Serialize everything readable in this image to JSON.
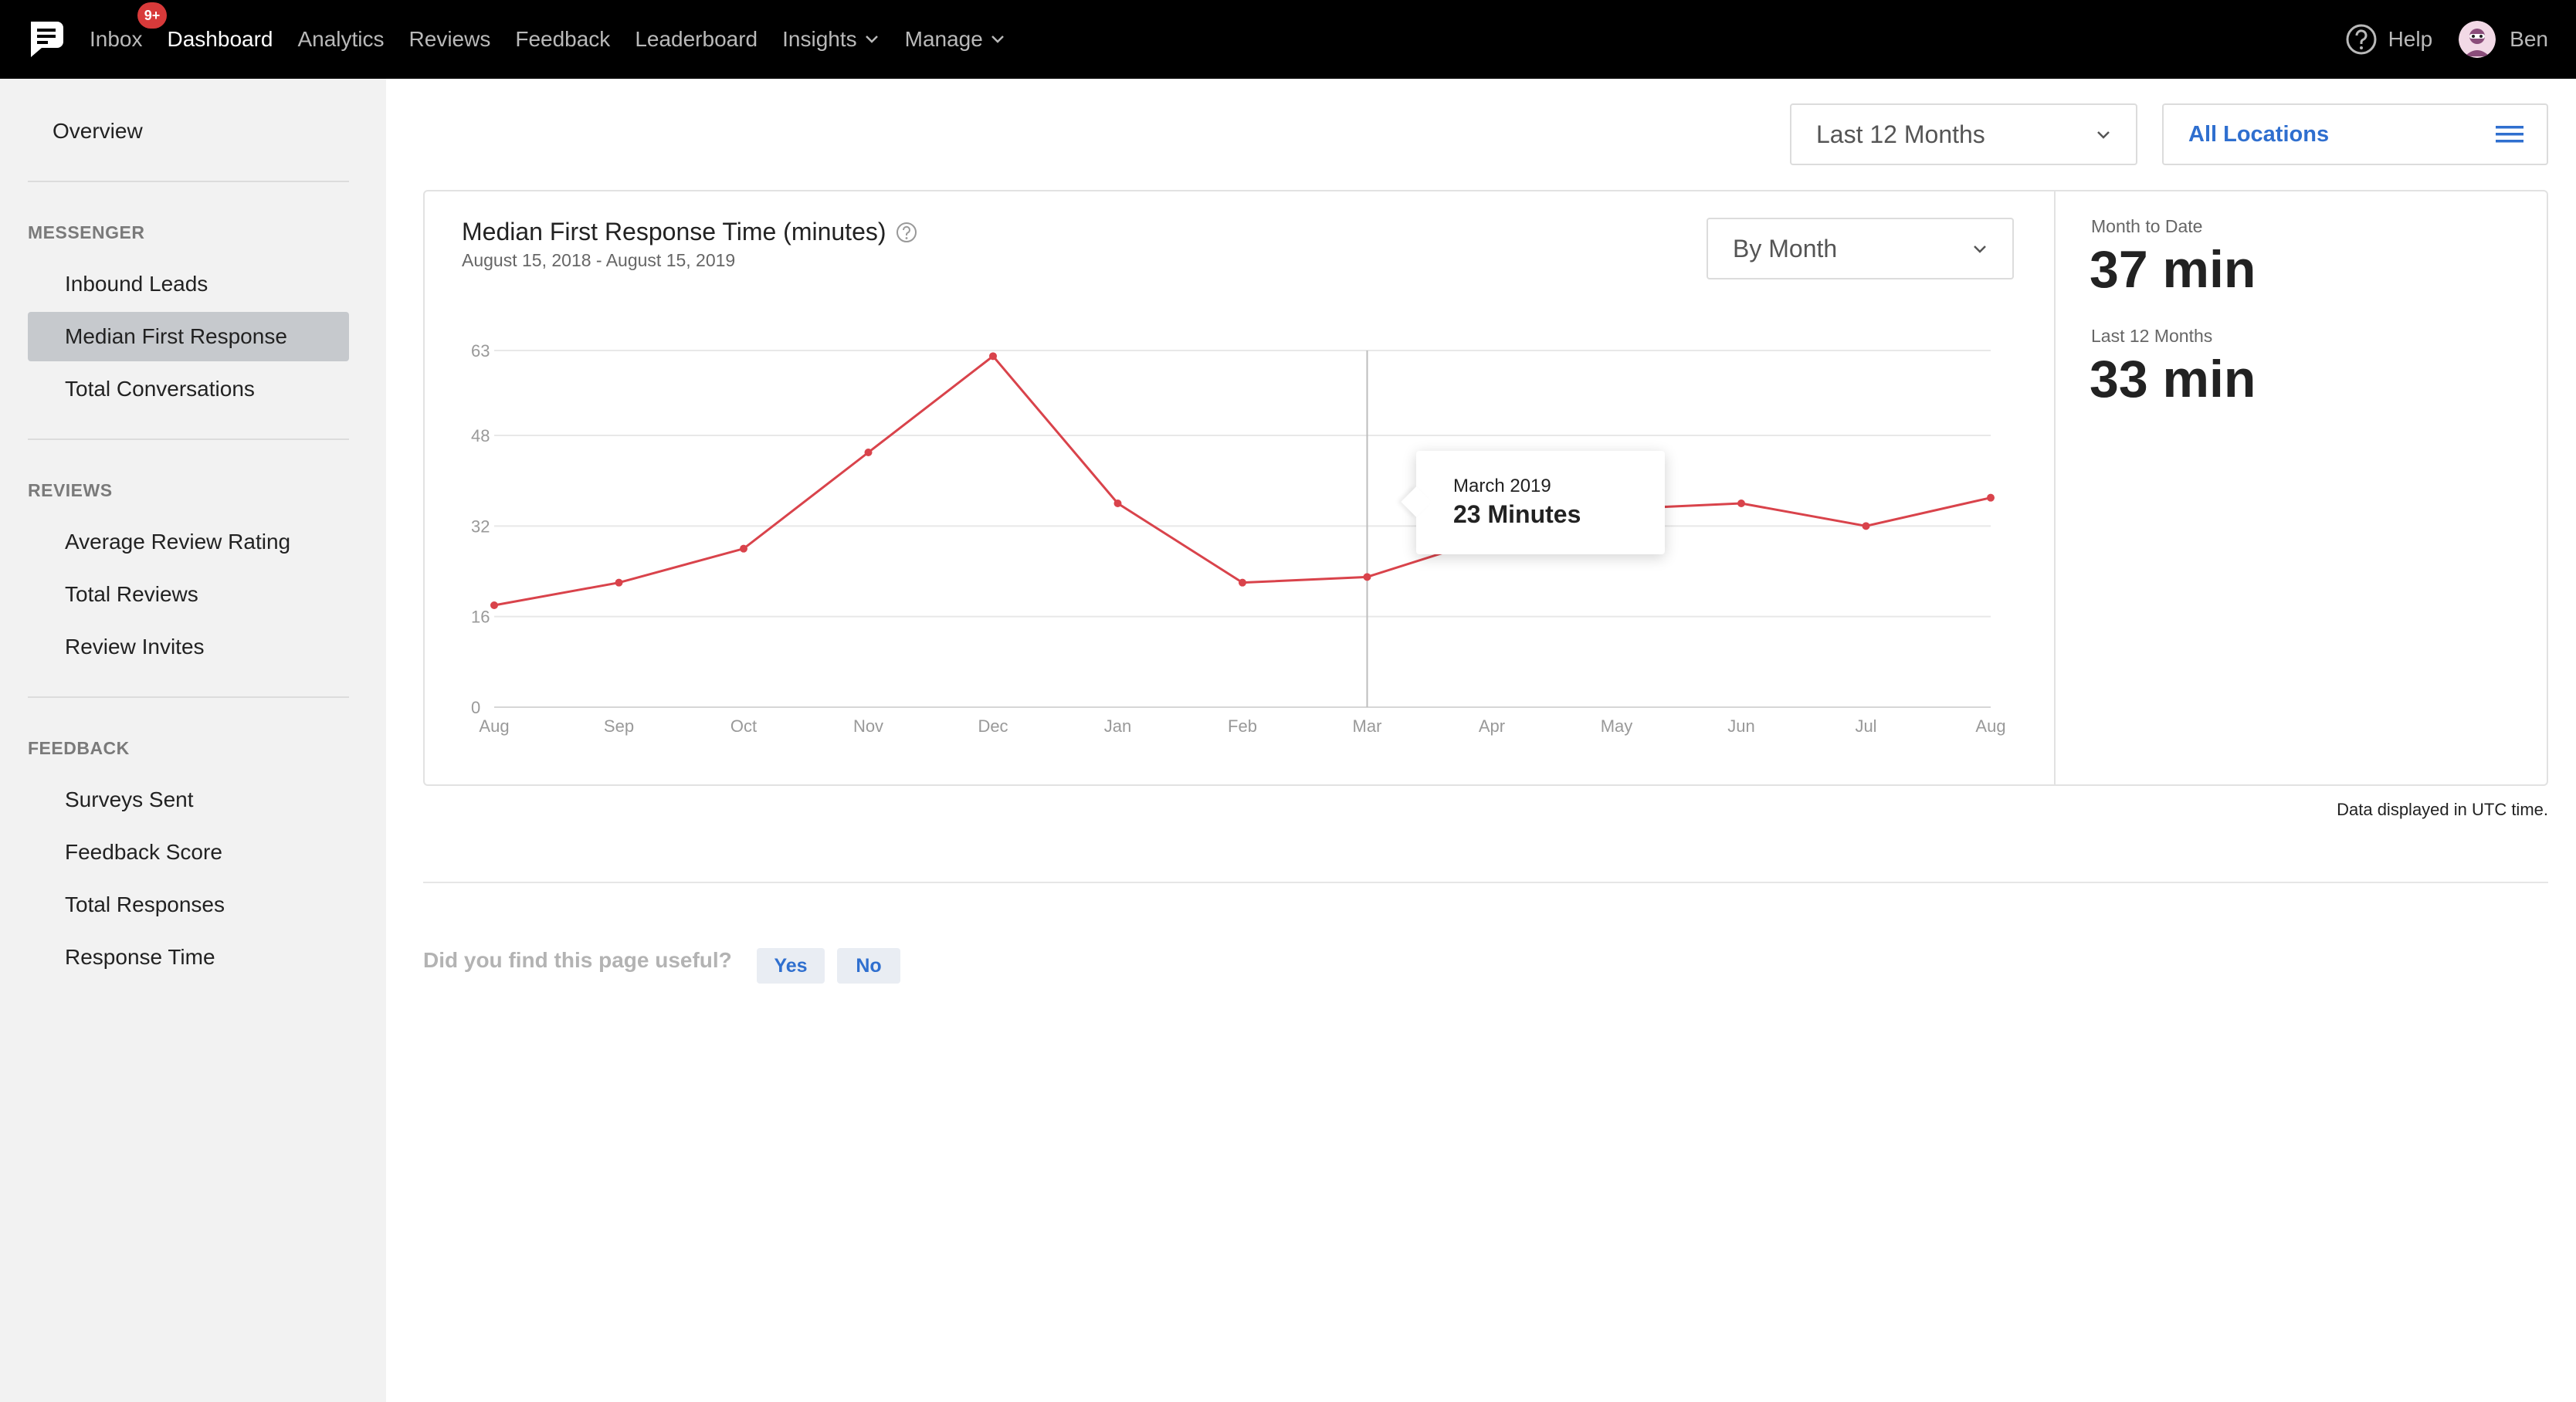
{
  "nav": {
    "inbox": "Inbox",
    "inbox_badge": "9+",
    "items": [
      "Dashboard",
      "Analytics",
      "Reviews",
      "Feedback",
      "Leaderboard",
      "Insights",
      "Manage"
    ],
    "active": "Dashboard",
    "help": "Help",
    "user": "Ben"
  },
  "sidebar": {
    "overview": "Overview",
    "sections": [
      {
        "title": "MESSENGER",
        "items": [
          "Inbound Leads",
          "Median First Response",
          "Total Conversations"
        ]
      },
      {
        "title": "REVIEWS",
        "items": [
          "Average Review Rating",
          "Total Reviews",
          "Review Invites"
        ]
      },
      {
        "title": "FEEDBACK",
        "items": [
          "Surveys Sent",
          "Feedback Score",
          "Total Responses",
          "Response Time"
        ]
      }
    ],
    "active_item": "Median First Response"
  },
  "filters": {
    "period": "Last 12 Months",
    "locations": "All Locations",
    "granularity": "By Month"
  },
  "card": {
    "title": "Median First Response Time (minutes)",
    "subtitle": "August 15, 2018 - August 15, 2019"
  },
  "stats": {
    "mtd_label": "Month to Date",
    "mtd_value": "37 min",
    "l12_label": "Last 12 Months",
    "l12_value": "33 min"
  },
  "tooltip": {
    "month": "March 2019",
    "value": "23 Minutes"
  },
  "footer": {
    "note": "Data displayed in UTC time.",
    "question": "Did you find this page useful?",
    "yes": "Yes",
    "no": "No"
  },
  "colors": {
    "line": "#d9434b",
    "link": "#2f6fcf",
    "badge": "#d83a3a"
  },
  "chart_data": {
    "type": "line",
    "categories": [
      "Aug",
      "Sep",
      "Oct",
      "Nov",
      "Dec",
      "Jan",
      "Feb",
      "Mar",
      "Apr",
      "May",
      "Jun",
      "Jul",
      "Aug"
    ],
    "series": [
      {
        "values": [
          18,
          22,
          28,
          45,
          62,
          36,
          22,
          23,
          30,
          35,
          36,
          32,
          37
        ]
      }
    ],
    "yticks": [
      0,
      16,
      32,
      48,
      63
    ],
    "ylim": [
      0,
      63
    ],
    "grid": true,
    "highlight_index": 7
  }
}
